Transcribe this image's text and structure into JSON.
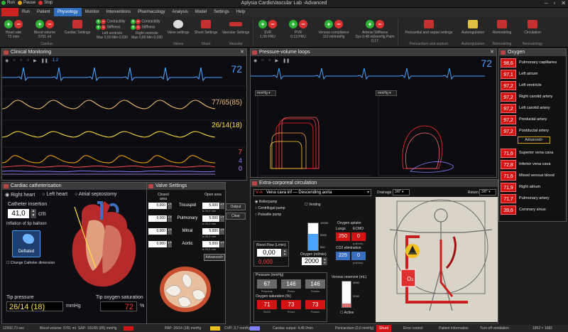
{
  "titlebar": {
    "run": "Run",
    "pause": "Pause",
    "stop": "Stop",
    "title": "Aplysia CardioVascular Lab -Advanced"
  },
  "menu": [
    "Run",
    "Patient",
    "Physiology",
    "Monitor",
    "Interventions",
    "Pharmacology",
    "Analysis",
    "Model",
    "Settings",
    "Help"
  ],
  "ribbon": {
    "heart_rate": "Heart rate\n72 /min",
    "blood_volume": "Blood volume\n5701 ml",
    "cardiac_settings": "Cardiac Settings",
    "cardiac_group": "Cardiac",
    "contractility": "Contractility",
    "stiffness": "Stiffness",
    "left_ventricle": "Left ventricle\nMax 0,50 Min 0,030",
    "right_ventricle": "Right ventricle\nMax 0,80 Min 0,030",
    "valve_settings": "Valve settings",
    "valves_group": "Valves",
    "shunt_settings": "Shunt Settings",
    "shunt_group": "Shunt",
    "vascular_settings": "Vascular Settings",
    "vascular_group": "Vascular",
    "svr": "SVR\n1,00 PRU",
    "pvr": "PVR\n0,13 PRU",
    "venous_compliance": "Venous compliance\n110 ml/mmHg",
    "arterial_stiffness": "Arterial Stiffness\nSys 0,48 ml/mmHg Pulm 0,17",
    "pericardial": "Pericardial and septal settings",
    "pericardium_group": "Pericardium and septum",
    "autoregulation": "Autoregulation",
    "autoreg_group": "Autoregulation",
    "remodeling": "Remodeling",
    "remodel_group": "Remodeling",
    "circulation": "Circulation",
    "neonat_group": "Neonatology"
  },
  "clinical": {
    "title": "Clinical Monitoring",
    "hr": "72",
    "bp": "77/65(85)",
    "pap": "26/14(18)",
    "cvp": "7",
    "v4": "4",
    "v0": "0",
    "tick": "1.2"
  },
  "pv": {
    "title": "Pressure-volume loops",
    "hr": "72",
    "unit": "mmHg"
  },
  "oxygen": {
    "title": "Oxygen",
    "top": [
      {
        "v": "98,6",
        "n": "Pulmonary capillaries"
      },
      {
        "v": "97,1",
        "n": "Left atrium"
      },
      {
        "v": "97,2",
        "n": "Left ventricle"
      },
      {
        "v": "97,2",
        "n": "Right carotid artery"
      },
      {
        "v": "97,2",
        "n": "Left carotid artery"
      },
      {
        "v": "97,2",
        "n": "Preductal artery"
      },
      {
        "v": "97,2",
        "n": "Postductal artery"
      }
    ],
    "advanced": "Advanced>",
    "bottom": [
      {
        "v": "71,6",
        "n": "Superior vena cava"
      },
      {
        "v": "72,8",
        "n": "Inferior vena cava"
      },
      {
        "v": "71,6",
        "n": "Mixed venous blood"
      },
      {
        "v": "71,9",
        "n": "Right atrium"
      },
      {
        "v": "71,7",
        "n": "Pulmonary artery"
      },
      {
        "v": "39,6",
        "n": "Coronary sinus"
      }
    ]
  },
  "cath": {
    "title": "Cardiac catheterisation",
    "opt1": "Right heart",
    "opt2": "Left heart",
    "opt3": "Atrial septostomy",
    "insert_label": "Catheter insertion",
    "insert_val": "41,0",
    "insert_unit": "cm",
    "balloon_label": "Inflation of tip balloon",
    "deflated": "Deflated",
    "change_dim": "Change Catheter dimension",
    "tip_pressure_label": "Tip pressure",
    "tip_pressure": "26/14 (18)",
    "tip_unit": "mmHg",
    "tip_o2_label": "Tip oxygen saturation",
    "tip_o2": "72",
    "tip_o2_unit": "%"
  },
  "valve": {
    "title": "Valve Settings",
    "hdr_closed": "Closed area",
    "hdr_open": "Open area",
    "rows": [
      {
        "n": "Tricuspid",
        "c": "0,000",
        "o": "5,000",
        "sub": "ø 25,2 mm"
      },
      {
        "n": "Pulmonary",
        "c": "0,000",
        "o": "5,000",
        "sub": "ø 25,2 mm"
      },
      {
        "n": "Mitral",
        "c": "0,000",
        "o": "5,000",
        "sub": "ø 25,2 mm"
      },
      {
        "n": "Aortic",
        "c": "0,000",
        "o": "5,000",
        "sub": "ø 25,2 mm"
      }
    ],
    "advanced": "Advanced>",
    "side1": "Output",
    "side2": "Clear"
  },
  "ecc": {
    "title": "Extra-corporeal circulation",
    "mode": "V-A",
    "route": "Vena cava inf — Descending aorta",
    "pumps": [
      "Rollerpump",
      "Centrifugal pump",
      "Pulsatile pump"
    ],
    "venting": "Venting",
    "bf_label": "Blood Flow (L/min)",
    "bf_val": "0,00",
    "bf_sub": "0,000",
    "oxy_label": "Oxygen (ml/min)",
    "oxy_val": "2000",
    "o2_uptake": "Oxygen uptake",
    "lungs": "Lungs",
    "ecmo": "ECMO",
    "lungs_v": "250",
    "ecmo_v": "0",
    "unit_mlmin": "(ml/min)",
    "co2_label": "CO2 elimination",
    "co2_l": "225",
    "co2_e": "0",
    "drainage": "Drainage",
    "drainage_v": "3/8\"",
    "return": "Return",
    "return_v": "3/8\"",
    "pressure_hdr": "Pressure (mmHg)",
    "prepump": "Prepump",
    "preox": "Preox",
    "postox": "Postox",
    "p1": "67",
    "p2": "146",
    "p3": "146",
    "o2sat_hdr": "Oxygen saturation (%)",
    "svo2": "SvO2",
    "preox2": "Preox",
    "postox2": "Postox",
    "s1": "71",
    "s2": "73",
    "s3": "73",
    "venous_res": "Venous reservoir (mL)",
    "active": "Active",
    "ticks1": [
      "10000",
      "5000",
      "500"
    ],
    "ticks2": [
      "4000",
      "2000"
    ]
  },
  "status": {
    "time": "12992,73 sec",
    "bv": "Blood volume: 5701 ml",
    "sap": "SAP: 101/65 (85) mmHg",
    "pap": "PAP: 26/14 (18) mmHg",
    "cvp": "CVP: 3,7 mmHg",
    "co": "Cardiac output: 4,45 l/min",
    "peri": "Pericardium (0,0 mmHg)",
    "shunt": "Shunt",
    "err": "Error control",
    "pinfo": "Patient information",
    "vent": "Turn off ventilation",
    "res": "1852 × 1082"
  },
  "colors": {
    "accent": "#2f6fbf",
    "alarm_red": "#d21414",
    "hr_blue": "#4aa3ff",
    "bp_orange": "#f0c070",
    "pap_yellow": "#ffe040",
    "cvp_red": "#ff5050"
  }
}
